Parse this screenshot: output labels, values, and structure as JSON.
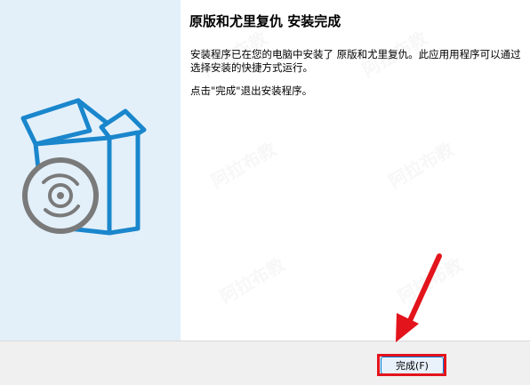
{
  "window": {
    "title": "原版和尤里复仇 安装完成",
    "description": "安装程序已在您的电脑中安装了 原版和尤里复仇。此应用用程序可以通过选择安装的快捷方式运行。",
    "finish_note": "点击\"完成\"退出安装程序。"
  },
  "buttons": {
    "finish_label": "完成(F)"
  },
  "watermark": {
    "text": "阿拉布教"
  },
  "colors": {
    "side_panel": "#e3f0fa",
    "box_outline": "#1a86cc",
    "disc": "#7a7a7a",
    "highlight": "#e3141c",
    "button_border": "#0078d4"
  },
  "icons": {
    "installer": "software-box-with-disc-icon"
  }
}
